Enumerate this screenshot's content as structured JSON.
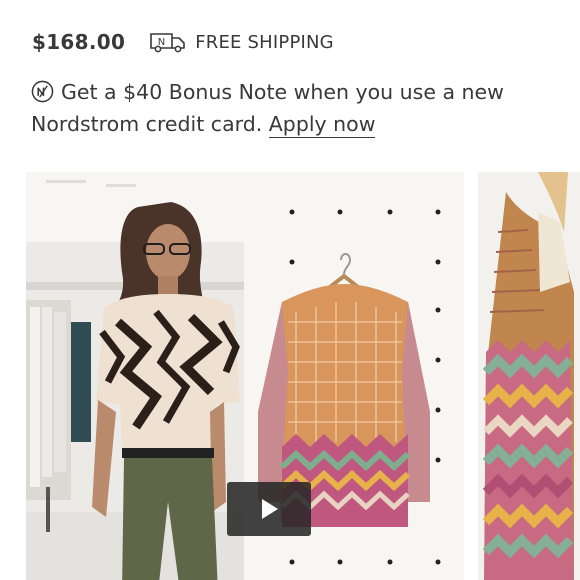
{
  "product": {
    "price": "$168.00",
    "shipping_label": "FREE SHIPPING",
    "truck_icon_letter": "N"
  },
  "promo": {
    "icon": "nordstrom-note-icon",
    "text": "Get a $40 Bonus Note when you use a new Nordstrom credit card.",
    "link_label": "Apply now"
  },
  "media": {
    "main_kind": "video",
    "play_icon": "play-icon",
    "next_kind": "image"
  },
  "colors": {
    "text": "#393939",
    "play_bg": "#282828"
  }
}
